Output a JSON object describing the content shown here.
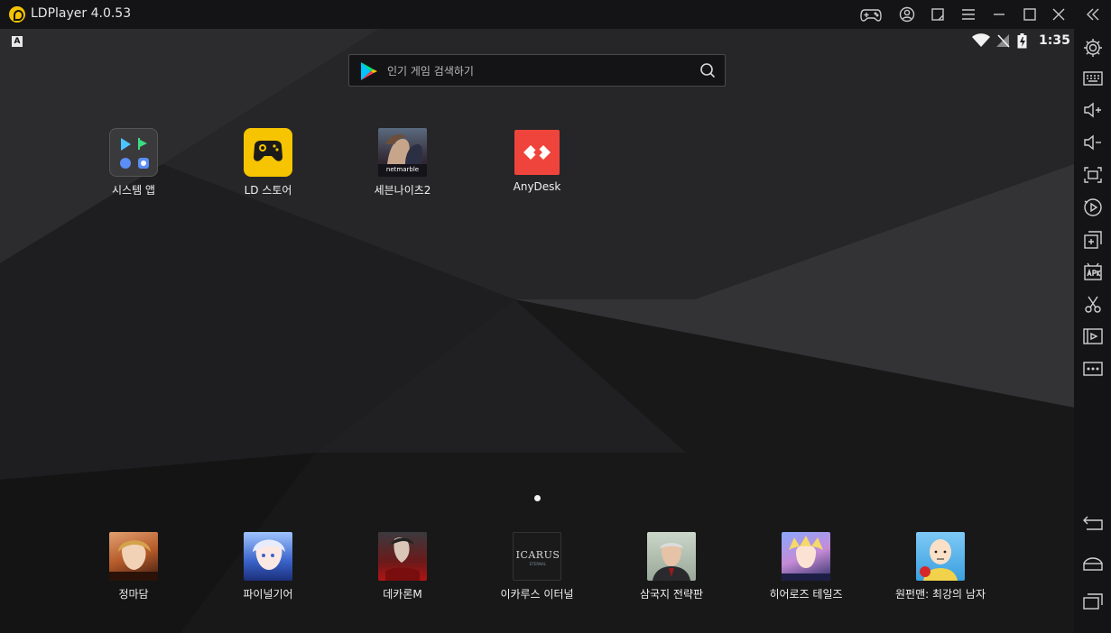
{
  "window": {
    "title": "LDPlayer 4.0.53"
  },
  "titlebar_buttons": [
    "gamepad-icon",
    "account-icon",
    "expand-icon",
    "menu-icon",
    "minimize-icon",
    "maximize-icon",
    "close-icon",
    "collapse-sidebar-icon"
  ],
  "status_bar": {
    "badge": "A",
    "time": "1:35"
  },
  "search": {
    "placeholder": "인기 게임 검색하기"
  },
  "apps": [
    {
      "label": "시스템 앱"
    },
    {
      "label": "LD 스토어"
    },
    {
      "label": "세븐나이츠2"
    },
    {
      "label": "AnyDesk"
    }
  ],
  "dock": [
    {
      "label": "정마담"
    },
    {
      "label": "파이널기어"
    },
    {
      "label": "데카론M"
    },
    {
      "label": "이카루스 이터널"
    },
    {
      "label": "삼국지 전략판"
    },
    {
      "label": "히어로즈 테일즈"
    },
    {
      "label": "원펀맨: 최강의 남자"
    }
  ],
  "icon_text": {
    "netmarble": "netmarble",
    "icarus": "ICARUS",
    "icarus_sub": "ETERNAL"
  },
  "sidebar": [
    "settings-icon",
    "keyboard-icon",
    "volume-up-icon",
    "volume-down-icon",
    "fullscreen-icon",
    "record-icon",
    "multi-instance-icon",
    "apk-icon",
    "scissors-icon",
    "video-icon",
    "more-icon",
    "back-icon",
    "home-icon",
    "recents-icon"
  ],
  "colors": {
    "accent": "#f6c400",
    "anydesk": "#ef443b"
  }
}
